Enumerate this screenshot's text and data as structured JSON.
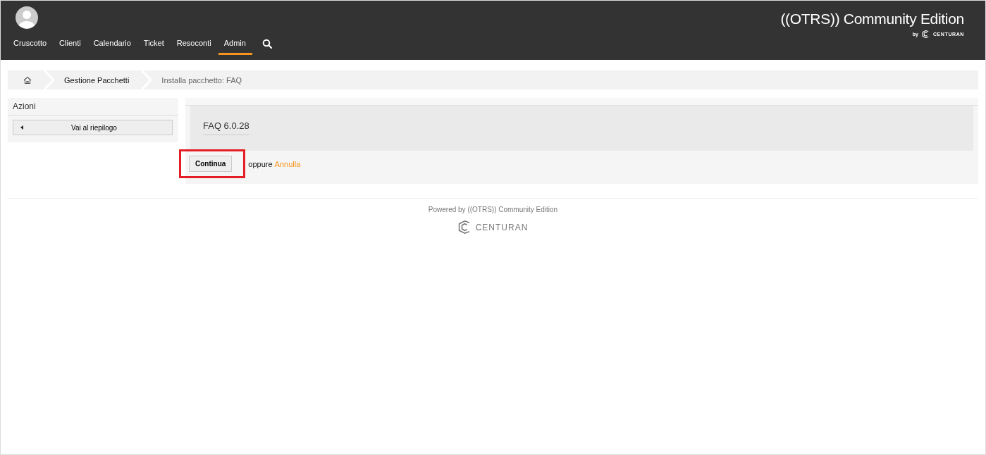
{
  "header": {
    "logo": "((OTRS)) Community Edition",
    "logo_by": "by",
    "logo_brand": "CENTURAN"
  },
  "nav": [
    {
      "label": "Cruscotto",
      "selected": false
    },
    {
      "label": "Clienti",
      "selected": false
    },
    {
      "label": "Calendario",
      "selected": false
    },
    {
      "label": "Ticket",
      "selected": false
    },
    {
      "label": "Resoconti",
      "selected": false
    },
    {
      "label": "Admin",
      "selected": true
    }
  ],
  "breadcrumb": [
    {
      "label": "Gestione Pacchetti",
      "kind": "link"
    },
    {
      "label": "Installa pacchetto: FAQ",
      "kind": "current"
    }
  ],
  "sidebar": {
    "title": "Azioni",
    "button": "Vai al riepilogo"
  },
  "content": {
    "package": "FAQ 6.0.28",
    "continue_button": "Continua",
    "or_text": "oppure",
    "cancel_link": "Annulla",
    "highlighted": true
  },
  "footer": {
    "powered_by": "Powered by ((OTRS)) Community Edition",
    "brand": "CENTURAN"
  }
}
